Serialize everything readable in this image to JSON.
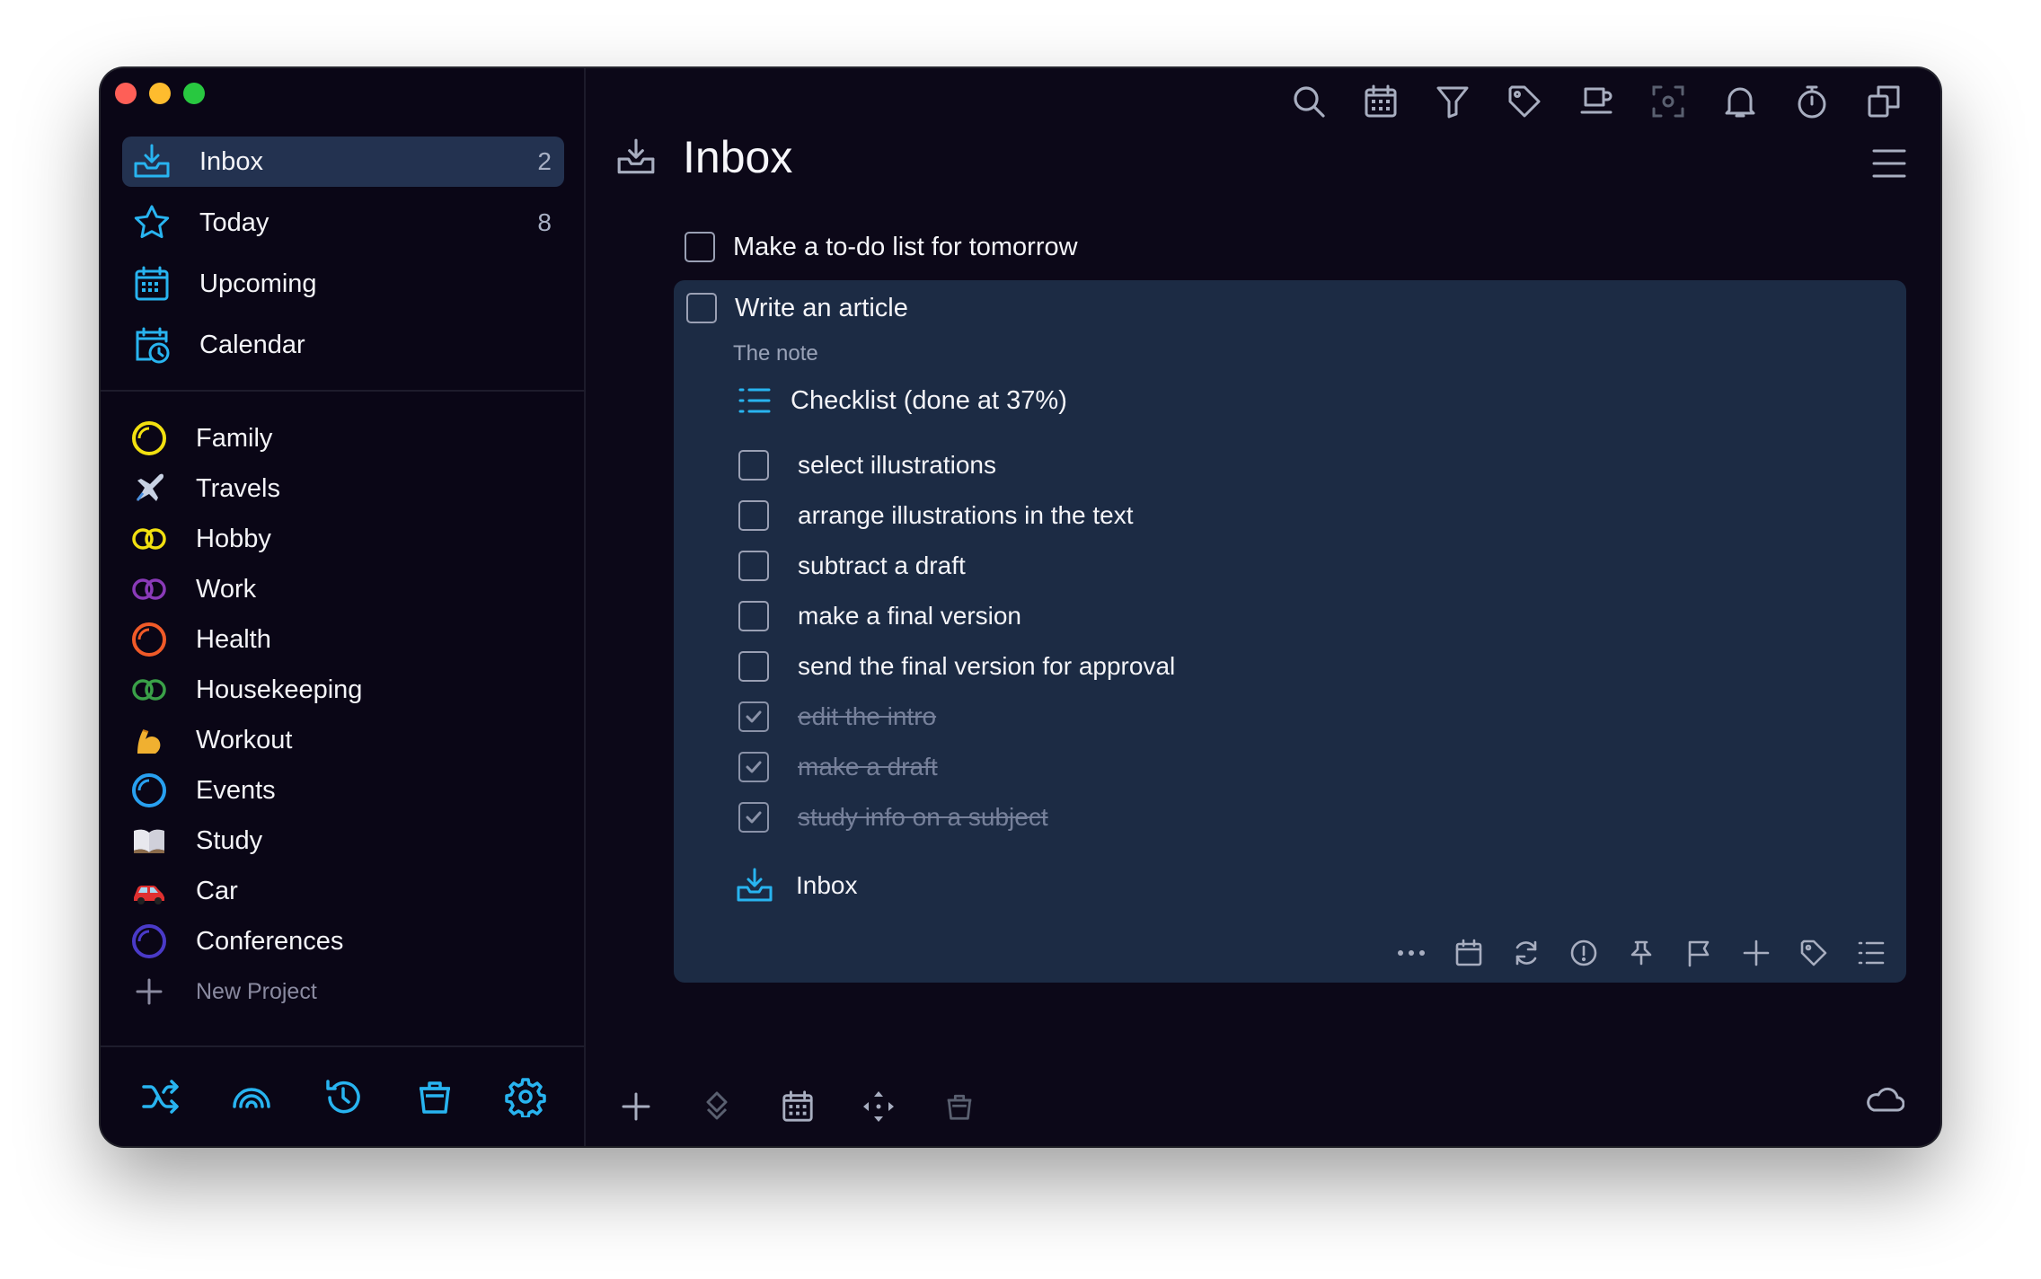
{
  "colors": {
    "accent": "#28b4f0",
    "window_bg": "#0c0818",
    "selected": "#233250",
    "card_bg": "#1c2b44",
    "muted": "#9aa3b8"
  },
  "sidebar": {
    "nav": [
      {
        "label": "Inbox",
        "count": "2",
        "icon": "inbox-icon"
      },
      {
        "label": "Today",
        "count": "8",
        "icon": "star-icon"
      },
      {
        "label": "Upcoming",
        "count": "",
        "icon": "calendar-grid-icon"
      },
      {
        "label": "Calendar",
        "count": "",
        "icon": "calendar-clock-icon"
      }
    ],
    "projects": [
      {
        "label": "Family",
        "icon": "yellow-circle-icon",
        "color": "#f2e010"
      },
      {
        "label": "Travels",
        "icon": "airplane-icon",
        "color": "#b8c4d8"
      },
      {
        "label": "Hobby",
        "icon": "yellow-rings-icon",
        "color": "#f2e010"
      },
      {
        "label": "Work",
        "icon": "purple-rings-icon",
        "color": "#8a3ab8"
      },
      {
        "label": "Health",
        "icon": "orange-circle-icon",
        "color": "#f05a28"
      },
      {
        "label": "Housekeeping",
        "icon": "green-rings-icon",
        "color": "#3aa048"
      },
      {
        "label": "Workout",
        "icon": "flexed-biceps-icon",
        "color": "#f0b030"
      },
      {
        "label": "Events",
        "icon": "blue-circle-icon",
        "color": "#28a0f0"
      },
      {
        "label": "Study",
        "icon": "book-icon",
        "color": "#d8d8e0"
      },
      {
        "label": "Car",
        "icon": "car-icon",
        "color": "#e03030"
      },
      {
        "label": "Conferences",
        "icon": "indigo-circle-icon",
        "color": "#4a3ac8"
      }
    ],
    "new_project": "New Project"
  },
  "main": {
    "title": "Inbox",
    "tasks": [
      {
        "title": "Make a to-do list for tomorrow"
      }
    ],
    "expanded": {
      "title": "Write an article",
      "note": "The note",
      "checklist_title": "Checklist (done at 37%)",
      "checklist": [
        {
          "text": "select illustrations",
          "done": false
        },
        {
          "text": "arrange illustrations in the text",
          "done": false
        },
        {
          "text": "subtract a draft",
          "done": false
        },
        {
          "text": "make a final version",
          "done": false
        },
        {
          "text": "send the final version for approval",
          "done": false
        },
        {
          "text": "edit the intro",
          "done": true
        },
        {
          "text": "make a draft",
          "done": true
        },
        {
          "text": "study info on a subject",
          "done": true
        }
      ],
      "project": "Inbox"
    }
  }
}
